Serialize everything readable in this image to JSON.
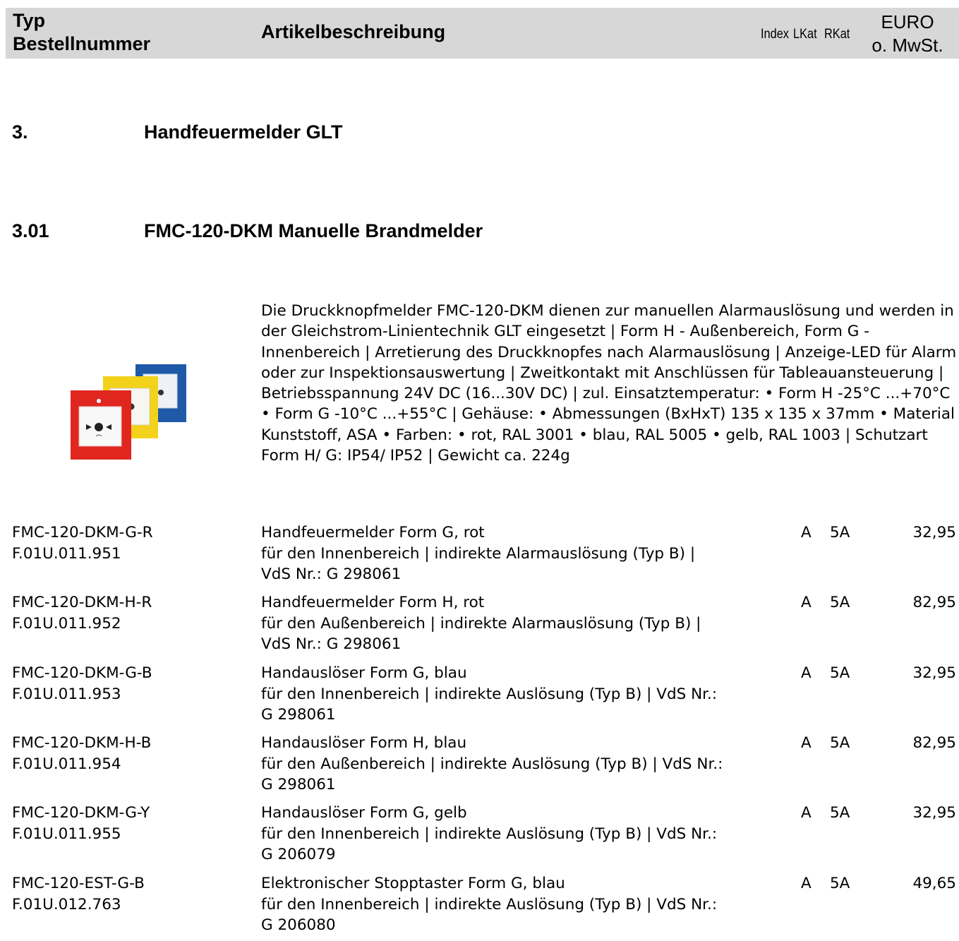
{
  "header": {
    "typ": "Typ",
    "bestellnummer": "Bestellnummer",
    "artikelbeschreibung": "Artikelbeschreibung",
    "index": "Index",
    "lkat": "LKat",
    "rkat": "RKat",
    "euro": "EURO",
    "mwst": "o. MwSt."
  },
  "section": {
    "number": "3.",
    "title": "Handfeuermelder GLT"
  },
  "subsection": {
    "number": "3.01",
    "title": "FMC-120-DKM Manuelle Brandmelder"
  },
  "intro": "Die Druckknopfmelder FMC-120-DKM dienen zur manuellen Alarmauslösung und werden in der Gleichstrom-Linientechnik GLT eingesetzt | Form H - Außenbereich, Form G - Innenbereich | Arretierung des Druckknopfes nach Alarmauslösung | Anzeige-LED für Alarm oder zur Inspektionsauswertung | Zweitkontakt mit Anschlüssen für Tableauansteuerung | Betriebsspannung 24V DC (16...30V DC) | zul. Einsatztemperatur: • Form H -25°C ...+70°C • Form G -10°C ...+55°C | Gehäuse: • Abmessungen (BxHxT) 135 x 135 x 37mm • Material Kunststoff, ASA • Farben: • rot, RAL 3001 • blau, RAL 5005 • gelb, RAL 1003 | Schutzart Form H/ G: IP54/ IP52 | Gewicht ca. 224g",
  "image": {
    "icon": "manual-call-point-product-photo",
    "colors": [
      "#e0261f",
      "#f2d21a",
      "#1f5aa8"
    ]
  },
  "products": [
    {
      "typ": "FMC-120-DKM-G-R",
      "bestellnummer": "F.01U.011.951",
      "title": "Handfeuermelder Form G, rot",
      "desc_line1": "für den Innenbereich | indirekte Alarmauslösung (Typ B) |",
      "desc_line2": "VdS Nr.: G 298061",
      "index": "A",
      "lkat": "5A",
      "price": "32,95"
    },
    {
      "typ": "FMC-120-DKM-H-R",
      "bestellnummer": "F.01U.011.952",
      "title": "Handfeuermelder Form H, rot",
      "desc_line1": "für den Außenbereich | indirekte Alarmauslösung (Typ B) |",
      "desc_line2": "VdS Nr.: G 298061",
      "index": "A",
      "lkat": "5A",
      "price": "82,95"
    },
    {
      "typ": "FMC-120-DKM-G-B",
      "bestellnummer": "F.01U.011.953",
      "title": "Handauslöser Form G, blau",
      "desc_line1": "für den Innenbereich | indirekte Auslösung (Typ B) | VdS Nr.:",
      "desc_line2": "G 298061",
      "index": "A",
      "lkat": "5A",
      "price": "32,95"
    },
    {
      "typ": "FMC-120-DKM-H-B",
      "bestellnummer": "F.01U.011.954",
      "title": "Handauslöser Form H, blau",
      "desc_line1": "für den Außenbereich | indirekte Auslösung (Typ B) | VdS Nr.:",
      "desc_line2": "G 298061",
      "index": "A",
      "lkat": "5A",
      "price": "82,95"
    },
    {
      "typ": "FMC-120-DKM-G-Y",
      "bestellnummer": "F.01U.011.955",
      "title": "Handauslöser Form G, gelb",
      "desc_line1": "für den Innenbereich | indirekte Auslösung (Typ B) | VdS Nr.:",
      "desc_line2": "G 206079",
      "index": "A",
      "lkat": "5A",
      "price": "32,95"
    },
    {
      "typ": "FMC-120-EST-G-B",
      "bestellnummer": "F.01U.012.763",
      "title": "Elektronischer Stopptaster Form G, blau",
      "desc_line1": "für den Innenbereich | indirekte Auslösung (Typ B) | VdS Nr.:",
      "desc_line2": "G 206080",
      "index": "A",
      "lkat": "5A",
      "price": "49,65"
    }
  ]
}
